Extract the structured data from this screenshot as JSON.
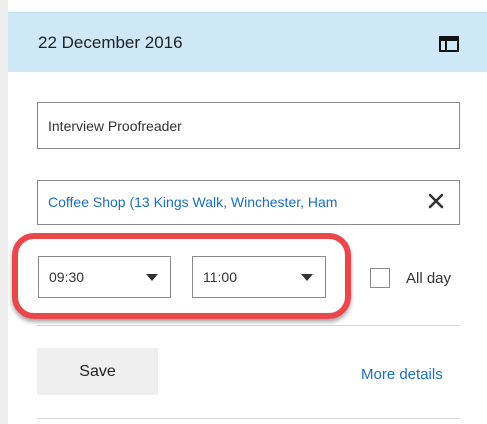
{
  "header": {
    "date": "22 December 2016",
    "calendar_icon": "calendar-icon"
  },
  "event": {
    "title_value": "Interview Proofreader",
    "location_value": "Coffee Shop (13 Kings Walk, Winchester, Ham",
    "clear_icon": "close-icon"
  },
  "time": {
    "start": "09:30",
    "end": "11:00",
    "all_day_label": "All day",
    "all_day_checked": false
  },
  "actions": {
    "save_label": "Save",
    "more_details_label": "More details"
  },
  "colors": {
    "header_bg": "#cfe8f8",
    "link": "#1a6fc2",
    "highlight": "#e8474c"
  }
}
